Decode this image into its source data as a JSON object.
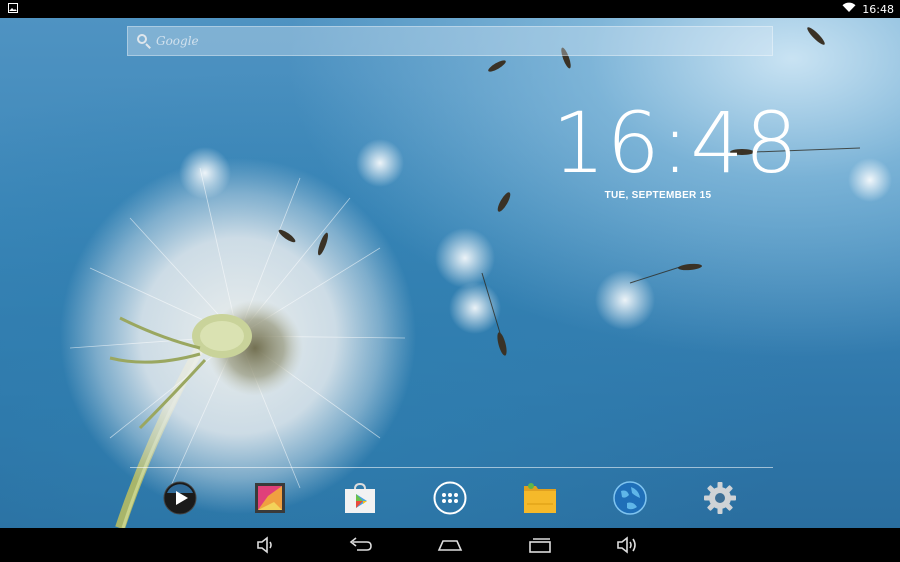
{
  "status_bar": {
    "time": "16:48",
    "notification_icon": "image-icon",
    "wifi_icon": "wifi-icon"
  },
  "search": {
    "placeholder": "Google",
    "icon": "search-icon"
  },
  "clock": {
    "time": "16:48",
    "date": "TUE, SEPTEMBER 15"
  },
  "dock": {
    "items": [
      {
        "name": "media-player-icon"
      },
      {
        "name": "gallery-icon"
      },
      {
        "name": "play-store-icon"
      },
      {
        "name": "app-drawer-icon"
      },
      {
        "name": "file-manager-icon"
      },
      {
        "name": "browser-icon"
      },
      {
        "name": "settings-icon"
      }
    ]
  },
  "nav_bar": {
    "buttons": [
      {
        "name": "volume-down-icon"
      },
      {
        "name": "back-icon"
      },
      {
        "name": "home-icon"
      },
      {
        "name": "recent-apps-icon"
      },
      {
        "name": "volume-up-icon"
      }
    ]
  },
  "colors": {
    "status_bar": "#000000",
    "nav_bar": "#000000",
    "wallpaper_sky": "#3c87b9"
  }
}
